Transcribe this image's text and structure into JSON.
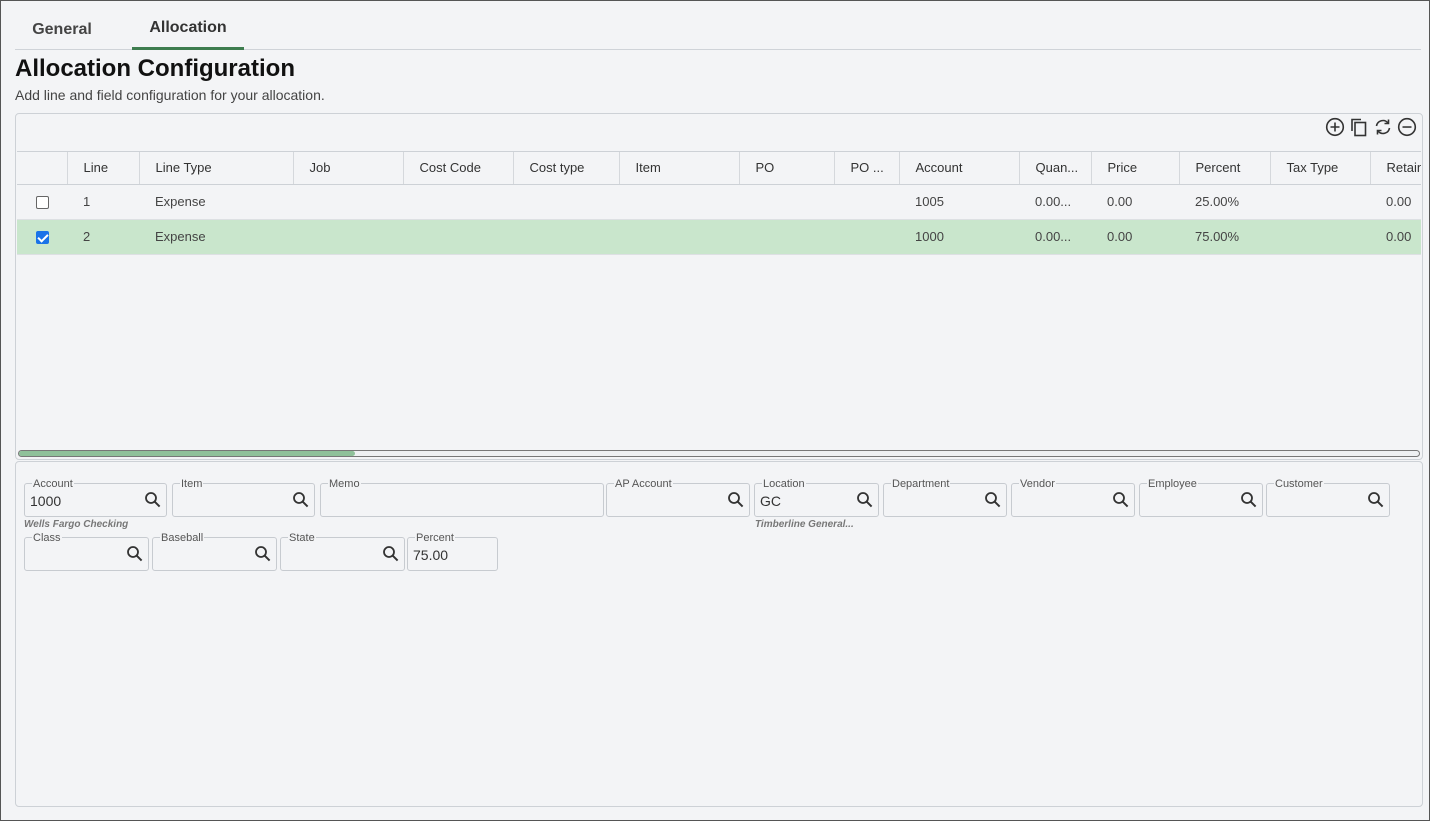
{
  "tabs": [
    {
      "label": "General"
    },
    {
      "label": "Allocation"
    }
  ],
  "header": {
    "title": "Allocation Configuration",
    "subtitle": "Add line and field configuration for your allocation."
  },
  "toolbar": {
    "icons": [
      "add-circle-icon",
      "copy-icon",
      "refresh-icon",
      "remove-circle-icon"
    ]
  },
  "grid": {
    "columns": [
      "",
      "Line",
      "Line Type",
      "Job",
      "Cost Code",
      "Cost type",
      "Item",
      "PO",
      "PO ...",
      "Account",
      "Quan...",
      "Price",
      "Percent",
      "Tax Type",
      "Retain"
    ],
    "rows": [
      {
        "checked": false,
        "line": "1",
        "line_type": "Expense",
        "job": "",
        "cost_code": "",
        "cost_type": "",
        "item": "",
        "po": "",
        "po_line": "",
        "account": "1005",
        "quantity": "0.00...",
        "price": "0.00",
        "percent": "25.00%",
        "tax_type": "",
        "retain": "0.00"
      },
      {
        "checked": true,
        "line": "2",
        "line_type": "Expense",
        "job": "",
        "cost_code": "",
        "cost_type": "",
        "item": "",
        "po": "",
        "po_line": "",
        "account": "1000",
        "quantity": "0.00...",
        "price": "0.00",
        "percent": "75.00%",
        "tax_type": "",
        "retain": "0.00"
      }
    ],
    "scroll_fraction": 0.24
  },
  "detail": {
    "account": {
      "label": "Account",
      "value": "1000",
      "hint": "Wells Fargo Checking"
    },
    "item": {
      "label": "Item",
      "value": ""
    },
    "memo": {
      "label": "Memo",
      "value": ""
    },
    "ap_account": {
      "label": "AP Account",
      "value": ""
    },
    "location": {
      "label": "Location",
      "value": "GC",
      "hint": "Timberline General..."
    },
    "department": {
      "label": "Department",
      "value": ""
    },
    "vendor": {
      "label": "Vendor",
      "value": ""
    },
    "employee": {
      "label": "Employee",
      "value": ""
    },
    "customer": {
      "label": "Customer",
      "value": ""
    },
    "class": {
      "label": "Class",
      "value": ""
    },
    "baseball": {
      "label": "Baseball",
      "value": ""
    },
    "state": {
      "label": "State",
      "value": ""
    },
    "percent": {
      "label": "Percent",
      "value": "75.00"
    }
  },
  "colors": {
    "accent": "#3e7d4f",
    "selected_row": "#c9e6cc",
    "checkbox": "#1a73e8"
  }
}
